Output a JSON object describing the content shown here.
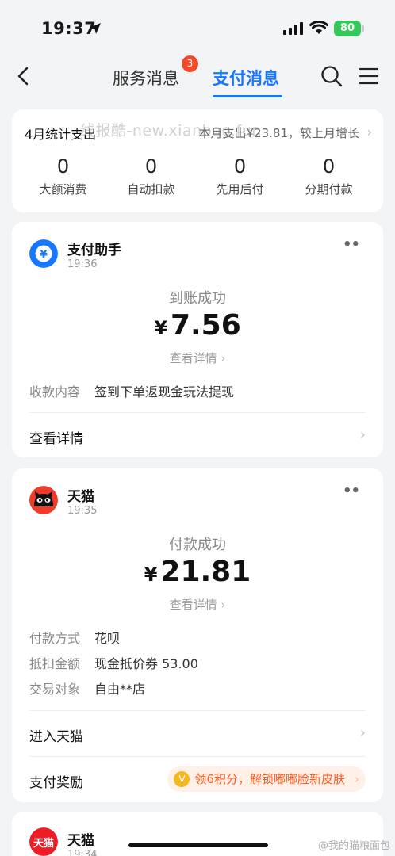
{
  "status_bar": {
    "time": "19:37",
    "battery": "80"
  },
  "nav": {
    "tabs": [
      {
        "label": "服务消息",
        "badge": "3"
      },
      {
        "label": "支付消息"
      }
    ]
  },
  "watermark": "线报酷-new.xianbao.fun",
  "summary": {
    "title": "4月统计支出",
    "right_text": "本月支出¥23.81，较上月增长",
    "stats": [
      {
        "value": "0",
        "label": "大额消费"
      },
      {
        "value": "0",
        "label": "自动扣款"
      },
      {
        "value": "0",
        "label": "先用后付"
      },
      {
        "value": "0",
        "label": "分期付款"
      }
    ]
  },
  "messages": [
    {
      "sender": "支付助手",
      "time": "19:36",
      "status": "到账成功",
      "currency": "¥",
      "amount": "7.56",
      "detail_link": "查看详情",
      "fields": [
        {
          "key": "收款内容",
          "value": "签到下单返现金玩法提现"
        }
      ],
      "action": "查看详情"
    },
    {
      "sender": "天猫",
      "time": "19:35",
      "status": "付款成功",
      "currency": "¥",
      "amount": "21.81",
      "detail_link": "查看详情",
      "fields": [
        {
          "key": "付款方式",
          "value": "花呗"
        },
        {
          "key": "抵扣金额",
          "value": "现金抵价券 53.00"
        },
        {
          "key": "交易对象",
          "value": "自由**店"
        }
      ],
      "action": "进入天猫",
      "reward_label": "支付奖励",
      "reward_promo": "领6积分，解锁嘟嘟脸新皮肤"
    },
    {
      "sender": "天猫",
      "time": "19:34",
      "avatar_text": "天猫"
    }
  ],
  "corner_watermark": "@我的猫粮面包",
  "colors": {
    "accent": "#1677ff",
    "badge": "#ee4b2b",
    "battery": "#34c759",
    "promo_text": "#ff5a1f"
  }
}
